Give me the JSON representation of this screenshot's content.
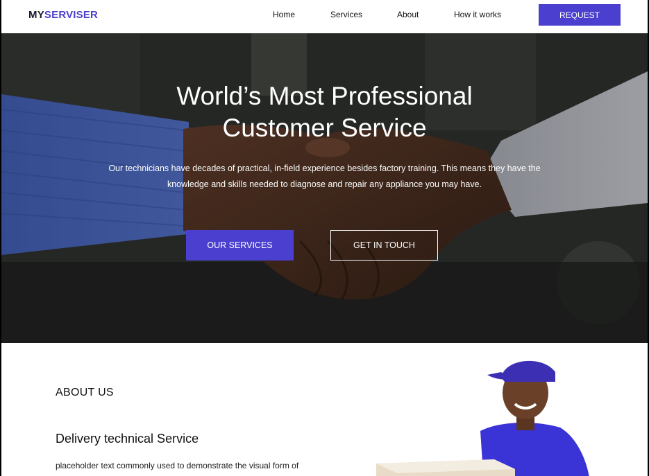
{
  "nav": {
    "logo_part1": "MY",
    "logo_part2": "SERVISER",
    "links": [
      "Home",
      "Services",
      "About",
      "How it works"
    ],
    "request_label": "REQUEST"
  },
  "hero": {
    "title_line1": "World’s Most Professional",
    "title_line2": "Customer Service",
    "description": "Our technicians have decades of practical, in-field experience besides factory training. This means they have the knowledge and skills needed to diagnose and repair any appliance you may have.",
    "primary_button": "OUR SERVICES",
    "secondary_button": "GET IN TOUCH"
  },
  "about": {
    "heading": "ABOUT US",
    "subheading": "Delivery technical Service",
    "text": "placeholder text commonly used to demonstrate the visual form of"
  },
  "colors": {
    "accent": "#4b3fcf",
    "logo_dark": "#1a1a2e",
    "hero_overlay": "#2d302d"
  }
}
